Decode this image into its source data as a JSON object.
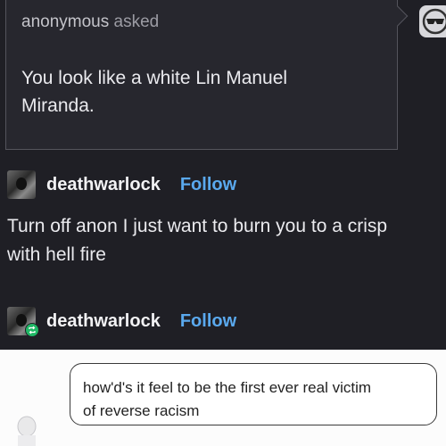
{
  "ask": {
    "asker": "anonymous",
    "verb": "asked",
    "question_line1": "You look like a white Lin Manuel",
    "question_line2": "Miranda."
  },
  "posts": [
    {
      "username": "deathwarlock",
      "follow_label": "Follow"
    },
    {
      "username": "deathwarlock",
      "follow_label": "Follow"
    }
  ],
  "reply": {
    "line1": "Turn off anon I just want to burn you to a crisp",
    "line2": "with hell fire"
  },
  "quote_image": {
    "line1": "how'd's it feel to be the first ever real victim",
    "line2": "of reverse racism"
  },
  "icons": {
    "anon_avatar": "anonymous-sunglasses-icon",
    "reblog": "reblog-icon"
  },
  "colors": {
    "follow": "#5aa9ee",
    "reblog_badge": "#1fb865",
    "background": "#1f1f25"
  }
}
